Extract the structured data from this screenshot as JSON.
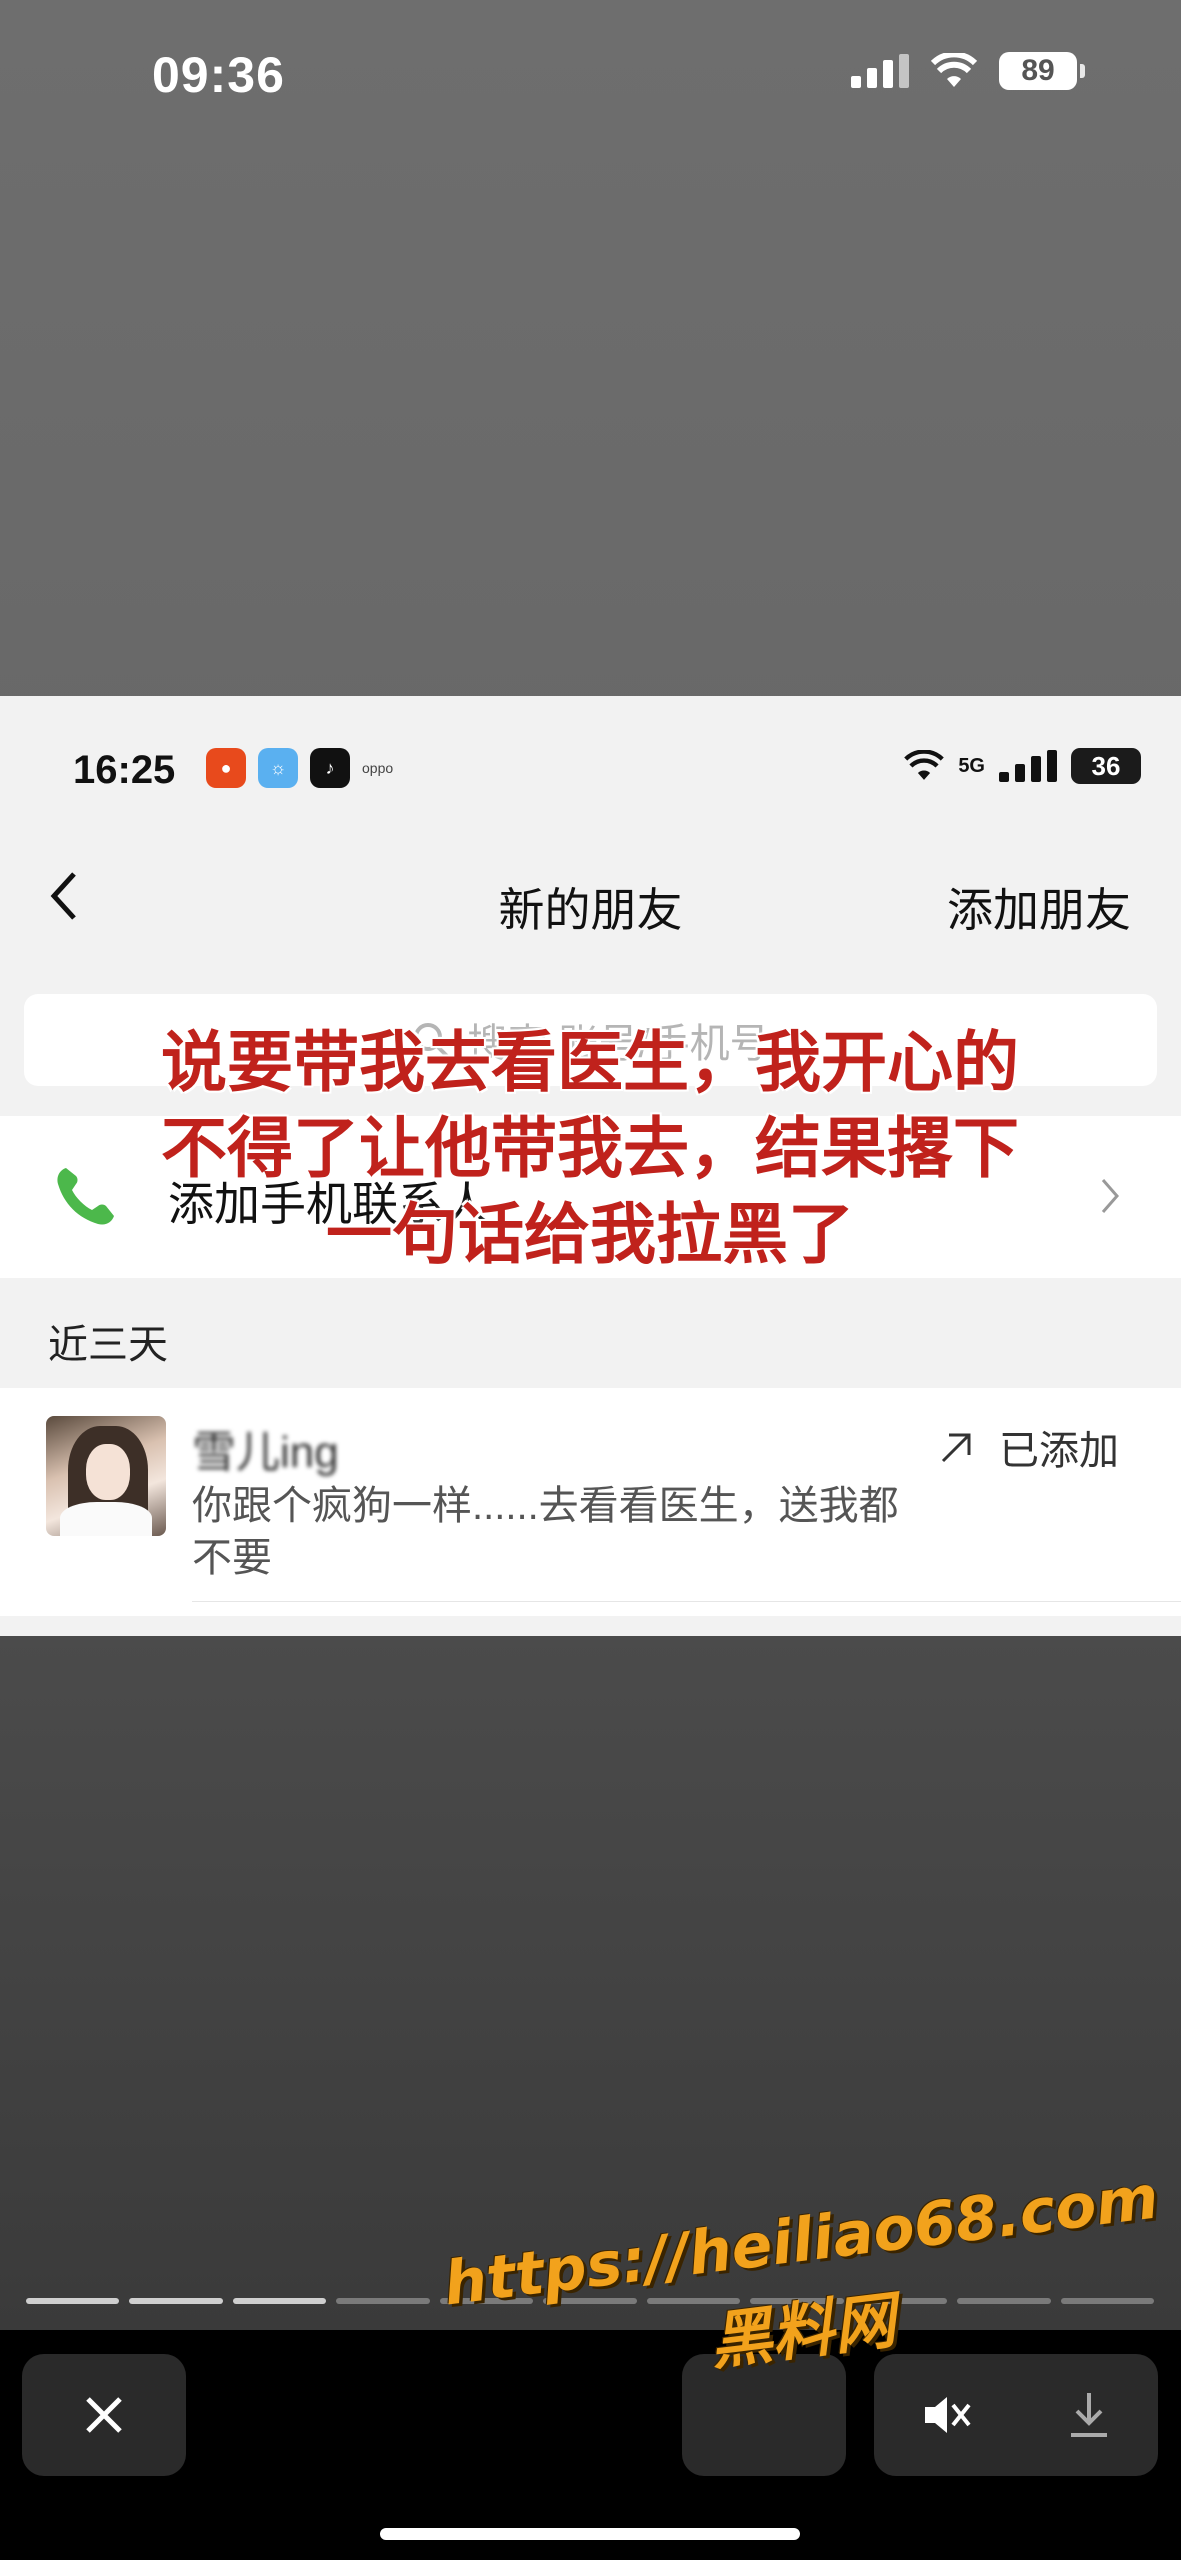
{
  "outer_status": {
    "time": "09:36",
    "battery": "89"
  },
  "inner_status": {
    "time": "16:25",
    "network": "5G",
    "battery": "36",
    "app_label": "oppo"
  },
  "navbar": {
    "title": "新的朋友",
    "action": "添加朋友"
  },
  "search": {
    "placeholder": "搜索 账号/手机号"
  },
  "add_contacts": {
    "label": "添加手机联系人"
  },
  "section": {
    "label": "近三天"
  },
  "friend": {
    "name": "雪儿ing",
    "message": "你跟个疯狗一样......去看看医生，送我都不要",
    "status": "已添加"
  },
  "overlay_caption": "说要带我去看医生，我开心的不得了让他带我去，结果撂下一句话给我拉黑了",
  "watermark": {
    "url": "https://heiliao68.com",
    "name": "黑料网"
  },
  "story_progress": {
    "total": 11,
    "viewed": 3
  },
  "colors": {
    "overlay_red": "#c0221c",
    "watermark_orange": "#f2a21c",
    "phone_green": "#4cb84b"
  }
}
